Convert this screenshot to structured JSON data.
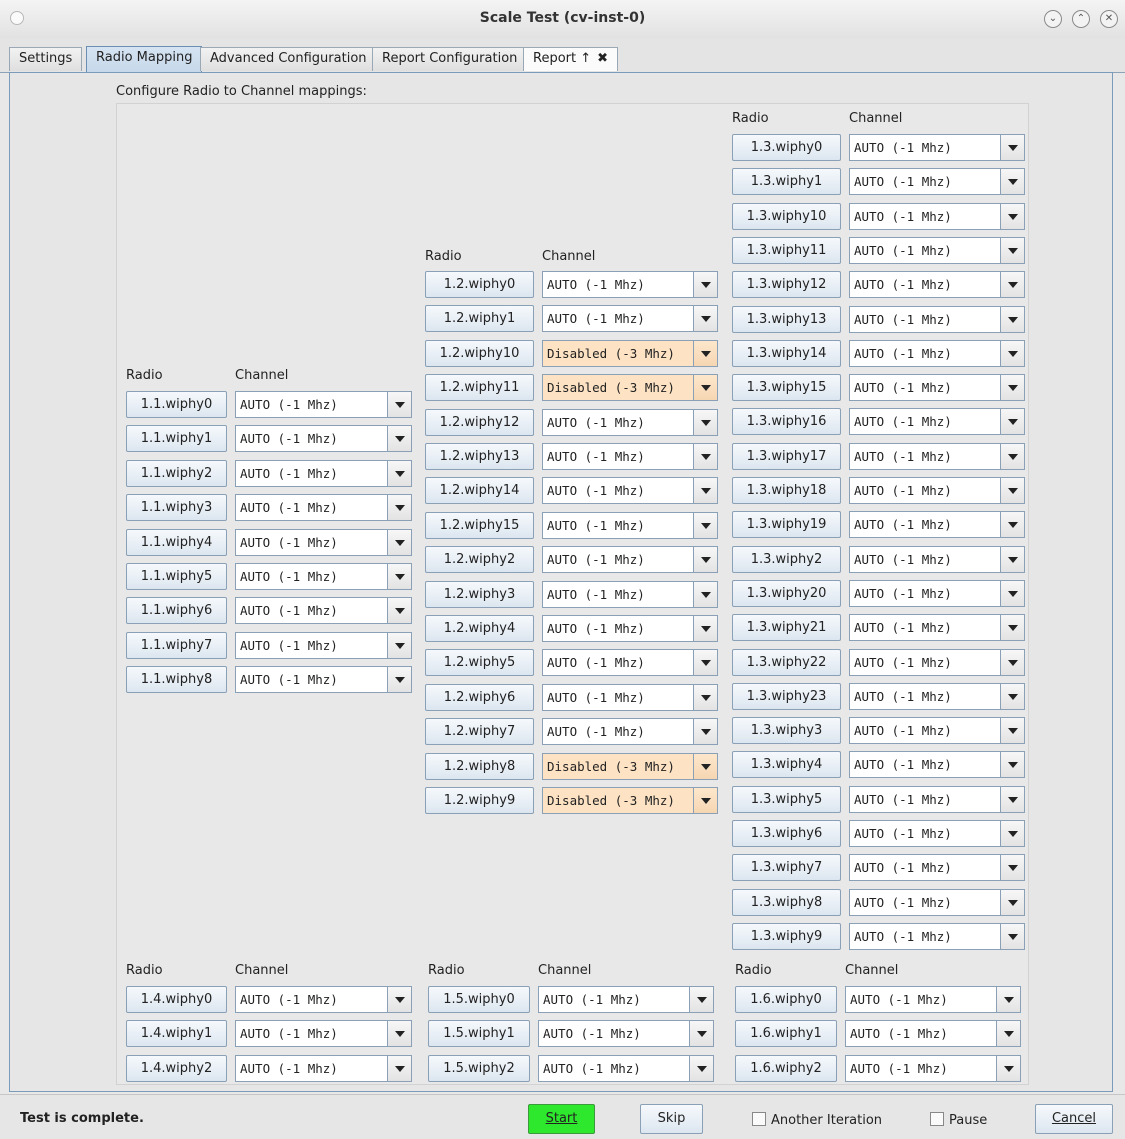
{
  "window": {
    "title": "Scale Test  (cv-inst-0)"
  },
  "tabs": [
    {
      "label": "Settings"
    },
    {
      "label": "Radio Mapping"
    },
    {
      "label": "Advanced Configuration"
    },
    {
      "label": "Report Configuration"
    },
    {
      "label": "Report ↑",
      "close": "✖"
    }
  ],
  "heading": "Configure Radio to Channel mappings:",
  "headers": {
    "radio": "Radio",
    "channel": "Channel"
  },
  "groups": [
    {
      "id": "g11",
      "rows": [
        {
          "radio": "1.1.wiphy0",
          "channel": "AUTO (-1 Mhz)"
        },
        {
          "radio": "1.1.wiphy1",
          "channel": "AUTO (-1 Mhz)"
        },
        {
          "radio": "1.1.wiphy2",
          "channel": "AUTO (-1 Mhz)"
        },
        {
          "radio": "1.1.wiphy3",
          "channel": "AUTO (-1 Mhz)"
        },
        {
          "radio": "1.1.wiphy4",
          "channel": "AUTO (-1 Mhz)"
        },
        {
          "radio": "1.1.wiphy5",
          "channel": "AUTO (-1 Mhz)"
        },
        {
          "radio": "1.1.wiphy6",
          "channel": "AUTO (-1 Mhz)"
        },
        {
          "radio": "1.1.wiphy7",
          "channel": "AUTO (-1 Mhz)"
        },
        {
          "radio": "1.1.wiphy8",
          "channel": "AUTO (-1 Mhz)"
        }
      ]
    },
    {
      "id": "g12",
      "rows": [
        {
          "radio": "1.2.wiphy0",
          "channel": "AUTO (-1 Mhz)"
        },
        {
          "radio": "1.2.wiphy1",
          "channel": "AUTO (-1 Mhz)"
        },
        {
          "radio": "1.2.wiphy10",
          "channel": "Disabled (-3 Mhz)",
          "disabled": true
        },
        {
          "radio": "1.2.wiphy11",
          "channel": "Disabled (-3 Mhz)",
          "disabled": true
        },
        {
          "radio": "1.2.wiphy12",
          "channel": "AUTO (-1 Mhz)"
        },
        {
          "radio": "1.2.wiphy13",
          "channel": "AUTO (-1 Mhz)"
        },
        {
          "radio": "1.2.wiphy14",
          "channel": "AUTO (-1 Mhz)"
        },
        {
          "radio": "1.2.wiphy15",
          "channel": "AUTO (-1 Mhz)"
        },
        {
          "radio": "1.2.wiphy2",
          "channel": "AUTO (-1 Mhz)"
        },
        {
          "radio": "1.2.wiphy3",
          "channel": "AUTO (-1 Mhz)"
        },
        {
          "radio": "1.2.wiphy4",
          "channel": "AUTO (-1 Mhz)"
        },
        {
          "radio": "1.2.wiphy5",
          "channel": "AUTO (-1 Mhz)"
        },
        {
          "radio": "1.2.wiphy6",
          "channel": "AUTO (-1 Mhz)"
        },
        {
          "radio": "1.2.wiphy7",
          "channel": "AUTO (-1 Mhz)"
        },
        {
          "radio": "1.2.wiphy8",
          "channel": "Disabled (-3 Mhz)",
          "disabled": true
        },
        {
          "radio": "1.2.wiphy9",
          "channel": "Disabled (-3 Mhz)",
          "disabled": true
        }
      ]
    },
    {
      "id": "g13",
      "rows": [
        {
          "radio": "1.3.wiphy0",
          "channel": "AUTO (-1 Mhz)"
        },
        {
          "radio": "1.3.wiphy1",
          "channel": "AUTO (-1 Mhz)"
        },
        {
          "radio": "1.3.wiphy10",
          "channel": "AUTO (-1 Mhz)"
        },
        {
          "radio": "1.3.wiphy11",
          "channel": "AUTO (-1 Mhz)"
        },
        {
          "radio": "1.3.wiphy12",
          "channel": "AUTO (-1 Mhz)"
        },
        {
          "radio": "1.3.wiphy13",
          "channel": "AUTO (-1 Mhz)"
        },
        {
          "radio": "1.3.wiphy14",
          "channel": "AUTO (-1 Mhz)"
        },
        {
          "radio": "1.3.wiphy15",
          "channel": "AUTO (-1 Mhz)"
        },
        {
          "radio": "1.3.wiphy16",
          "channel": "AUTO (-1 Mhz)"
        },
        {
          "radio": "1.3.wiphy17",
          "channel": "AUTO (-1 Mhz)"
        },
        {
          "radio": "1.3.wiphy18",
          "channel": "AUTO (-1 Mhz)"
        },
        {
          "radio": "1.3.wiphy19",
          "channel": "AUTO (-1 Mhz)"
        },
        {
          "radio": "1.3.wiphy2",
          "channel": "AUTO (-1 Mhz)"
        },
        {
          "radio": "1.3.wiphy20",
          "channel": "AUTO (-1 Mhz)"
        },
        {
          "radio": "1.3.wiphy21",
          "channel": "AUTO (-1 Mhz)"
        },
        {
          "radio": "1.3.wiphy22",
          "channel": "AUTO (-1 Mhz)"
        },
        {
          "radio": "1.3.wiphy23",
          "channel": "AUTO (-1 Mhz)"
        },
        {
          "radio": "1.3.wiphy3",
          "channel": "AUTO (-1 Mhz)"
        },
        {
          "radio": "1.3.wiphy4",
          "channel": "AUTO (-1 Mhz)"
        },
        {
          "radio": "1.3.wiphy5",
          "channel": "AUTO (-1 Mhz)"
        },
        {
          "radio": "1.3.wiphy6",
          "channel": "AUTO (-1 Mhz)"
        },
        {
          "radio": "1.3.wiphy7",
          "channel": "AUTO (-1 Mhz)"
        },
        {
          "radio": "1.3.wiphy8",
          "channel": "AUTO (-1 Mhz)"
        },
        {
          "radio": "1.3.wiphy9",
          "channel": "AUTO (-1 Mhz)"
        }
      ]
    },
    {
      "id": "g14",
      "rows": [
        {
          "radio": "1.4.wiphy0",
          "channel": "AUTO (-1 Mhz)"
        },
        {
          "radio": "1.4.wiphy1",
          "channel": "AUTO (-1 Mhz)"
        },
        {
          "radio": "1.4.wiphy2",
          "channel": "AUTO (-1 Mhz)"
        }
      ]
    },
    {
      "id": "g15",
      "rows": [
        {
          "radio": "1.5.wiphy0",
          "channel": "AUTO (-1 Mhz)"
        },
        {
          "radio": "1.5.wiphy1",
          "channel": "AUTO (-1 Mhz)"
        },
        {
          "radio": "1.5.wiphy2",
          "channel": "AUTO (-1 Mhz)"
        }
      ]
    },
    {
      "id": "g16",
      "rows": [
        {
          "radio": "1.6.wiphy0",
          "channel": "AUTO (-1 Mhz)"
        },
        {
          "radio": "1.6.wiphy1",
          "channel": "AUTO (-1 Mhz)"
        },
        {
          "radio": "1.6.wiphy2",
          "channel": "AUTO (-1 Mhz)"
        }
      ]
    }
  ],
  "footer": {
    "status": "Test is complete.",
    "start": "Start",
    "skip": "Skip",
    "another_iteration": "Another Iteration",
    "pause": "Pause",
    "cancel": "Cancel"
  },
  "colors": {
    "disabled_bg": "#fde2c4",
    "start_bg": "#2ee82e",
    "accent": "#7b9bbb"
  }
}
